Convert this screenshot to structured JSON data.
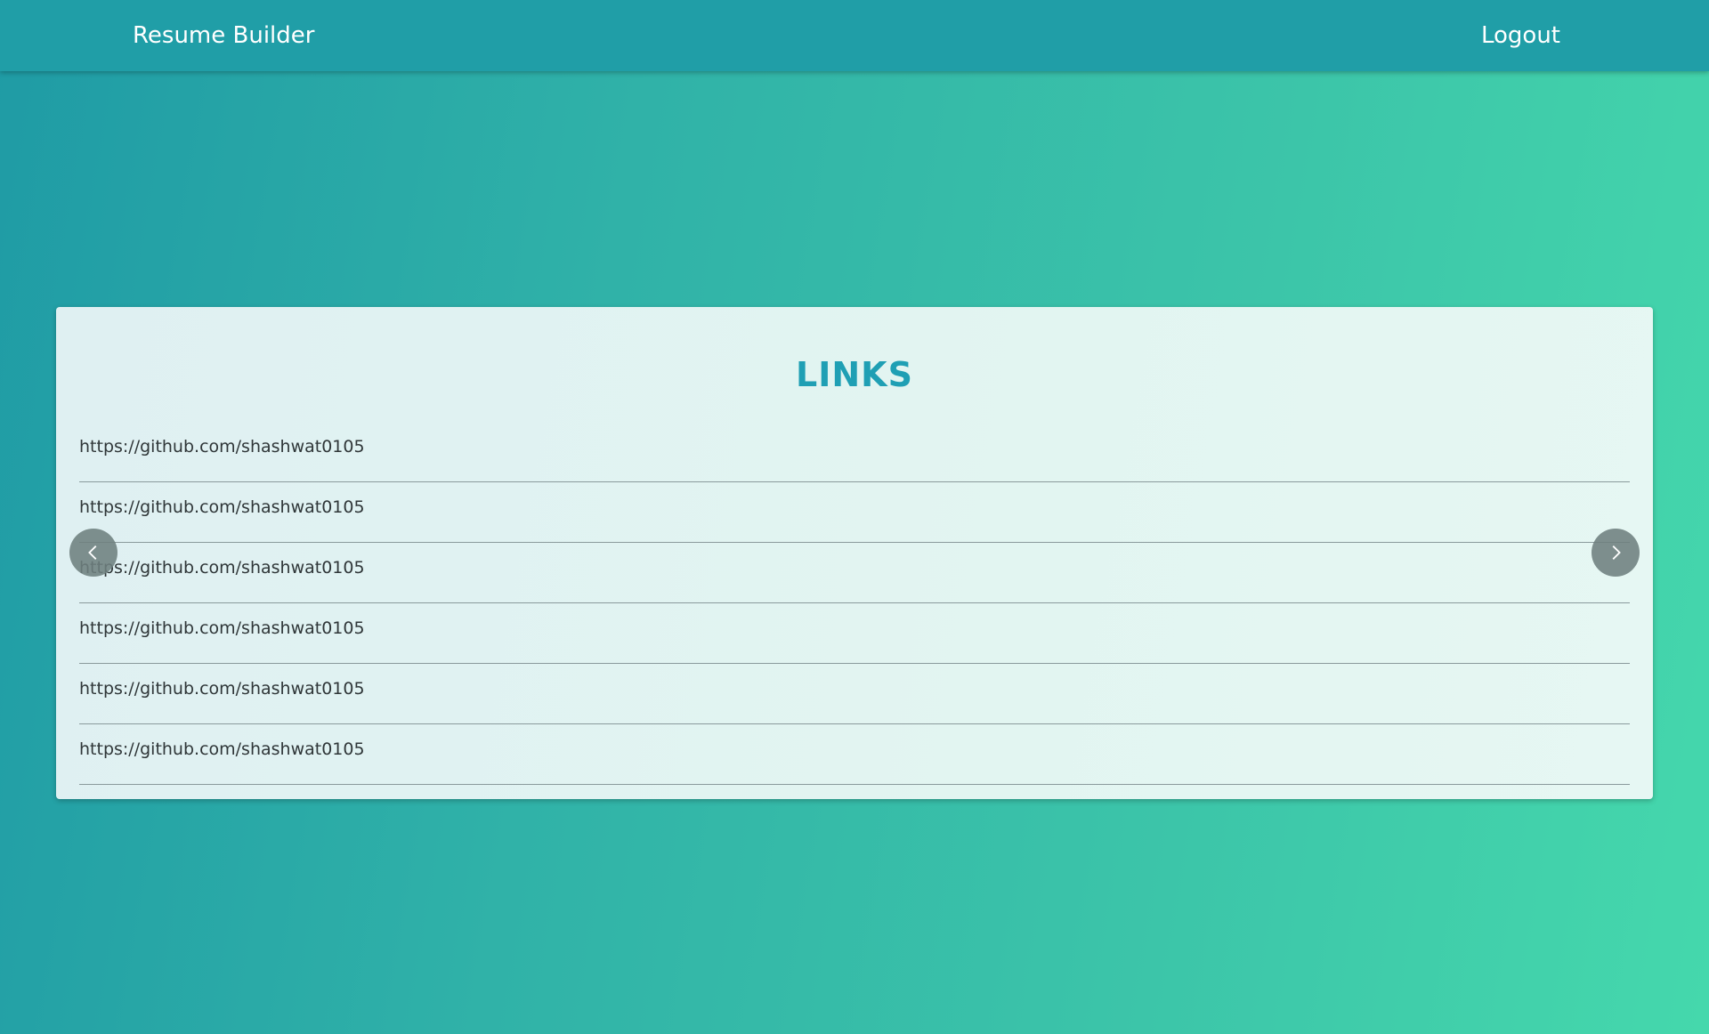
{
  "navbar": {
    "brand": "Resume Builder",
    "logout_label": "Logout",
    "background": "#209ea7"
  },
  "section": {
    "title": "LINKS",
    "title_color": "#1f9fb4"
  },
  "links": [
    "https://github.com/shashwat0105",
    "https://github.com/shashwat0105",
    "https://github.com/shashwat0105",
    "https://github.com/shashwat0105",
    "https://github.com/shashwat0105",
    "https://github.com/shashwat0105"
  ],
  "carousel": {
    "prev_icon": "chevron-left-icon",
    "next_icon": "chevron-right-icon"
  }
}
